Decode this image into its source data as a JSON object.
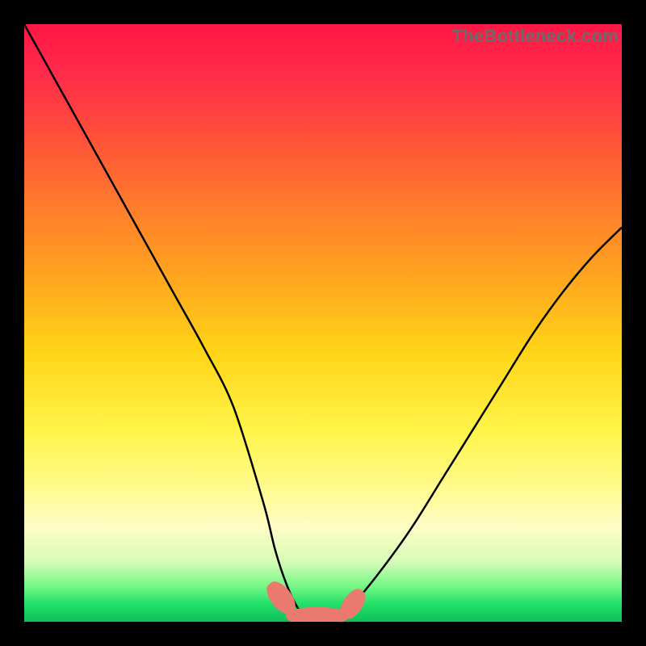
{
  "watermark": "TheBottleneck.com",
  "chart_data": {
    "type": "line",
    "title": "",
    "xlabel": "",
    "ylabel": "",
    "xlim": [
      0,
      100
    ],
    "ylim": [
      0,
      100
    ],
    "grid": false,
    "legend": false,
    "color_gradient": {
      "top": "#ff1744",
      "mid": "#fff44a",
      "bottom": "#0fbf5a"
    },
    "series": [
      {
        "name": "bottleneck-curve",
        "x": [
          0,
          5,
          10,
          15,
          20,
          25,
          30,
          35,
          40,
          42,
          44,
          46,
          48,
          50,
          52,
          54,
          56,
          60,
          65,
          70,
          75,
          80,
          85,
          90,
          95,
          100
        ],
        "y": [
          100,
          91,
          82,
          73,
          64,
          55,
          46,
          36,
          20,
          12,
          6,
          2,
          0.5,
          0,
          0.5,
          2,
          4,
          9,
          16,
          24,
          32,
          40,
          48,
          55,
          61,
          66
        ]
      }
    ],
    "markers": [
      {
        "name": "blob-left",
        "x_center": 43,
        "y_center": 4
      },
      {
        "name": "blob-mid",
        "x_center": 49,
        "y_center": 1
      },
      {
        "name": "blob-right",
        "x_center": 55,
        "y_center": 3
      }
    ]
  }
}
